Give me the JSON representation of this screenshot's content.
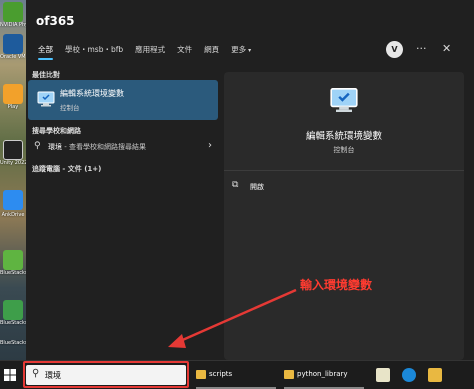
{
  "desktop": {
    "icons": [
      {
        "label": "NVIDIA PhysX",
        "color": "#4a9d2f"
      },
      {
        "label": "Oracle VM Virtual...",
        "color": "#1e5b9c"
      },
      {
        "label": "Play",
        "color": "#f2a12b"
      },
      {
        "label": "Unity 2022",
        "color": "#222222"
      },
      {
        "label": "Tasks",
        "color": "#2d8cf0"
      },
      {
        "label": "AnkDrive",
        "color": "#3f7bd8"
      },
      {
        "label": "BlueStacks 5",
        "color": "#5fb441"
      },
      {
        "label": "BlueStacks 64-bit",
        "color": "#3e9e4a"
      },
      {
        "label": "BlueStacks",
        "color": "#2a8c54"
      }
    ]
  },
  "panel": {
    "title": "of365",
    "tabs": [
      {
        "label": "全部",
        "active": true
      },
      {
        "label": "學校・msb・bfb",
        "active": false
      },
      {
        "label": "應用程式",
        "active": false
      },
      {
        "label": "文件",
        "active": false
      },
      {
        "label": "網頁",
        "active": false
      },
      {
        "label": "更多",
        "active": false,
        "caret": "▾"
      }
    ],
    "avatar_letter": "V",
    "more_icon": "···",
    "close_icon": "✕"
  },
  "results": {
    "best_match_label": "最佳比對",
    "best_match": {
      "title": "編輯系統環境變數",
      "subtitle": "控制台"
    },
    "web_search_label": "搜尋學校和網路",
    "web_item": {
      "query": "環境",
      "suffix": " - 查看學校和網路搜尋結果",
      "icon": "magnifier-icon"
    },
    "documents_label": "追蹤電腦 - 文件 (1+)"
  },
  "detail": {
    "title": "編輯系統環境變數",
    "subtitle": "控制台",
    "open_label": "開啟"
  },
  "annotation": {
    "text": "輸入環境變數",
    "color": "#ff3b30"
  },
  "taskbar": {
    "search_value": "環境",
    "items": [
      {
        "label": "scripts"
      },
      {
        "label": "python_library"
      }
    ]
  }
}
